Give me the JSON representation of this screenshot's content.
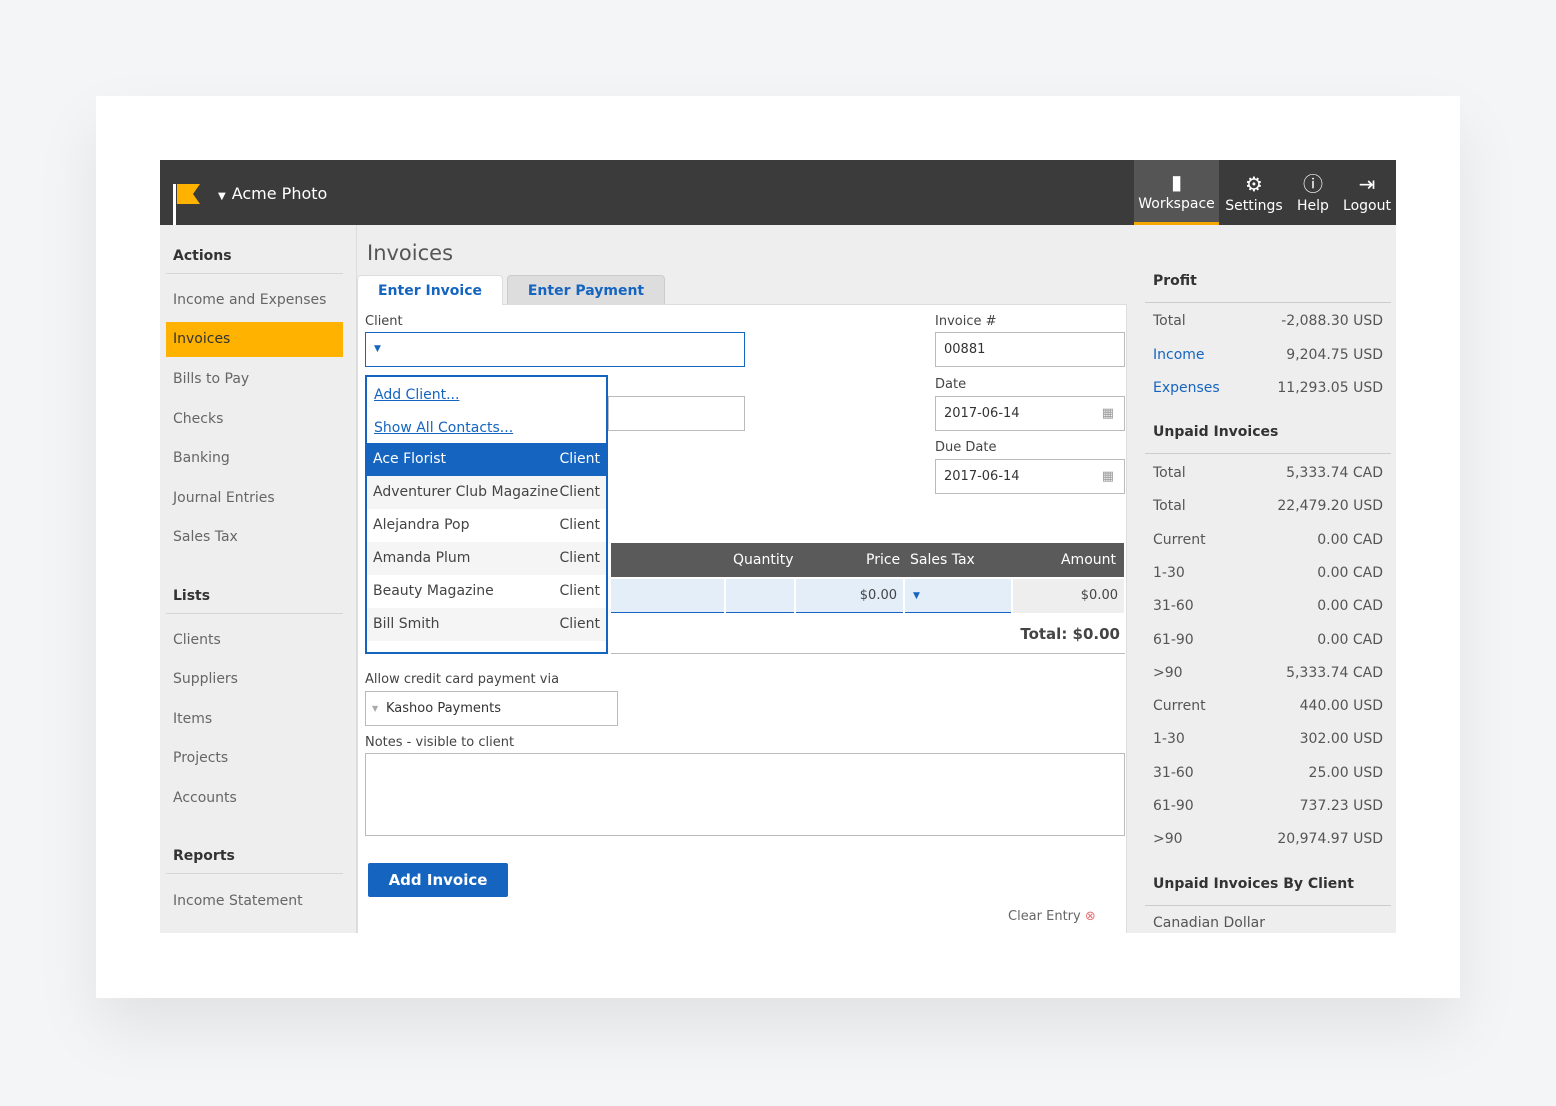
{
  "header": {
    "org": "Acme Photo",
    "nav": [
      {
        "label": "Workspace",
        "icon": "workspace-icon"
      },
      {
        "label": "Settings",
        "icon": "gear-icon"
      },
      {
        "label": "Help",
        "icon": "help-icon"
      },
      {
        "label": "Logout",
        "icon": "logout-icon"
      }
    ]
  },
  "sidebar": {
    "actions_title": "Actions",
    "actions": [
      "Income and Expenses",
      "Invoices",
      "Bills to Pay",
      "Checks",
      "Banking",
      "Journal Entries",
      "Sales Tax"
    ],
    "lists_title": "Lists",
    "lists": [
      "Clients",
      "Suppliers",
      "Items",
      "Projects",
      "Accounts"
    ],
    "reports_title": "Reports",
    "reports": [
      "Income Statement"
    ]
  },
  "main": {
    "title": "Invoices",
    "tabs": [
      "Enter Invoice",
      "Enter Payment"
    ],
    "client_label": "Client",
    "client_value": "",
    "invoice_no_label": "Invoice #",
    "invoice_no": "00881",
    "date_label": "Date",
    "date": "2017-06-14",
    "due_label": "Due Date",
    "due_date": "2017-06-14",
    "dropdown": {
      "links": [
        "Add Client...",
        "Show All Contacts..."
      ],
      "options": [
        {
          "name": "Ace Florist",
          "type": "Client"
        },
        {
          "name": "Adventurer Club Magazine",
          "type": "Client"
        },
        {
          "name": "Alejandra Pop",
          "type": "Client"
        },
        {
          "name": "Amanda Plum",
          "type": "Client"
        },
        {
          "name": "Beauty Magazine",
          "type": "Client"
        },
        {
          "name": "Bill Smith",
          "type": "Client"
        }
      ]
    },
    "table": {
      "headers": [
        "Quantity",
        "Price",
        "Sales Tax",
        "Amount"
      ],
      "row": {
        "price": "$0.00",
        "amount": "$0.00"
      },
      "total": "Total: $0.00"
    },
    "cc_label": "Allow credit card payment via",
    "cc_value": "Kashoo Payments",
    "notes_label": "Notes - visible to client",
    "add_button": "Add Invoice",
    "clear_entry": "Clear Entry"
  },
  "right": {
    "profit_title": "Profit",
    "profit": [
      {
        "k": "Total",
        "v": "-2,088.30 USD"
      },
      {
        "k": "Income",
        "v": "9,204.75 USD"
      },
      {
        "k": "Expenses",
        "v": "11,293.05 USD"
      }
    ],
    "unpaid_title": "Unpaid Invoices",
    "unpaid": [
      {
        "k": "Total",
        "v": "5,333.74 CAD"
      },
      {
        "k": "Total",
        "v": "22,479.20 USD"
      },
      {
        "k": "Current",
        "v": "0.00 CAD"
      },
      {
        "k": "1-30",
        "v": "0.00 CAD"
      },
      {
        "k": "31-60",
        "v": "0.00 CAD"
      },
      {
        "k": "61-90",
        "v": "0.00 CAD"
      },
      {
        "k": ">90",
        "v": "5,333.74 CAD"
      },
      {
        "k": "Current",
        "v": "440.00 USD"
      },
      {
        "k": "1-30",
        "v": "302.00 USD"
      },
      {
        "k": "31-60",
        "v": "25.00 USD"
      },
      {
        "k": "61-90",
        "v": "737.23 USD"
      },
      {
        "k": ">90",
        "v": "20,974.97 USD"
      }
    ],
    "by_client_title": "Unpaid Invoices By Client",
    "by_client_first": "Canadian Dollar"
  },
  "colors": {
    "accent": "#1565c0",
    "highlight": "#ffb300",
    "header": "#3b3b3b"
  }
}
